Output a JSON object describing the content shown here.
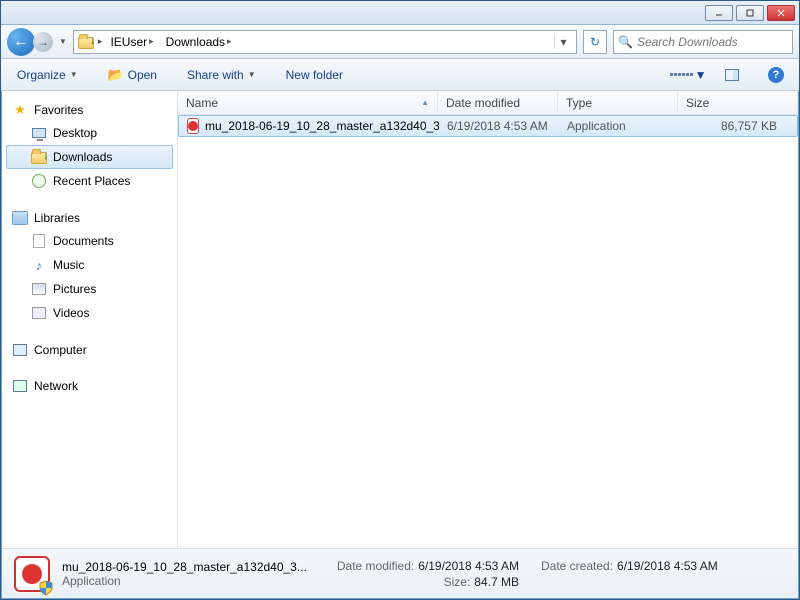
{
  "breadcrumbs": [
    "IEUser",
    "Downloads"
  ],
  "search": {
    "placeholder": "Search Downloads"
  },
  "toolbar": {
    "organize": "Organize",
    "open": "Open",
    "share": "Share with",
    "newfolder": "New folder"
  },
  "nav": {
    "favorites": {
      "label": "Favorites",
      "items": [
        {
          "label": "Desktop"
        },
        {
          "label": "Downloads",
          "selected": true
        },
        {
          "label": "Recent Places"
        }
      ]
    },
    "libraries": {
      "label": "Libraries",
      "items": [
        {
          "label": "Documents"
        },
        {
          "label": "Music"
        },
        {
          "label": "Pictures"
        },
        {
          "label": "Videos"
        }
      ]
    },
    "computer": {
      "label": "Computer"
    },
    "network": {
      "label": "Network"
    }
  },
  "columns": {
    "name": "Name",
    "date": "Date modified",
    "type": "Type",
    "size": "Size"
  },
  "files": [
    {
      "name": "mu_2018-06-19_10_28_master_a132d40_3...",
      "date": "6/19/2018 4:53 AM",
      "type": "Application",
      "size": "86,757 KB",
      "selected": true
    }
  ],
  "details": {
    "name": "mu_2018-06-19_10_28_master_a132d40_3...",
    "type": "Application",
    "modified_label": "Date modified:",
    "modified": "6/19/2018 4:53 AM",
    "size_label": "Size:",
    "size": "84.7 MB",
    "created_label": "Date created:",
    "created": "6/19/2018 4:53 AM"
  }
}
